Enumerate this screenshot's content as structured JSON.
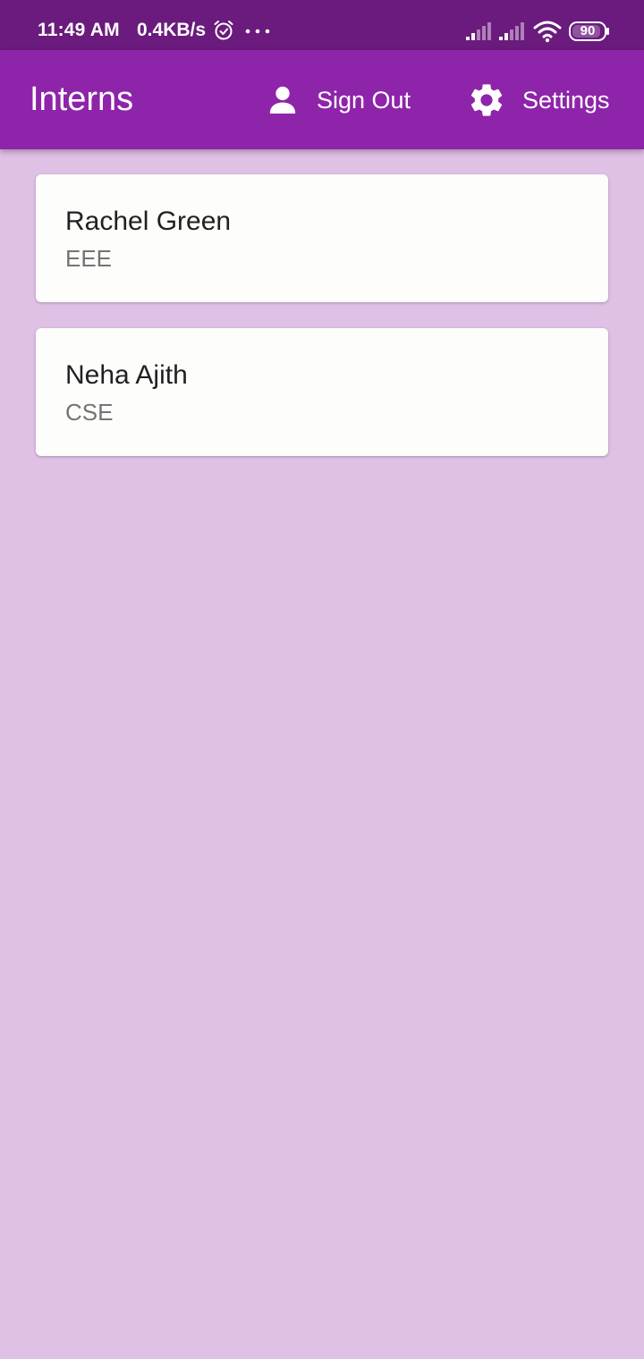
{
  "status_bar": {
    "time": "11:49 AM",
    "network_speed": "0.4KB/s",
    "battery_level": "90",
    "icons": [
      "alarm-icon",
      "more-dots-icon",
      "signal-icon",
      "signal-icon",
      "wifi-icon",
      "battery-icon"
    ]
  },
  "app_bar": {
    "title": "Interns",
    "sign_out_label": "Sign Out",
    "sign_out_icon": "person-icon",
    "settings_label": "Settings",
    "settings_icon": "gear-icon",
    "color": "#8e24aa"
  },
  "interns": [
    {
      "name": "Rachel Green",
      "department": "EEE"
    },
    {
      "name": "Neha Ajith",
      "department": "CSE"
    }
  ],
  "colors": {
    "status_bar": "#6a1b7d",
    "background": "#dfc1e6",
    "card": "#fdfdfb"
  }
}
